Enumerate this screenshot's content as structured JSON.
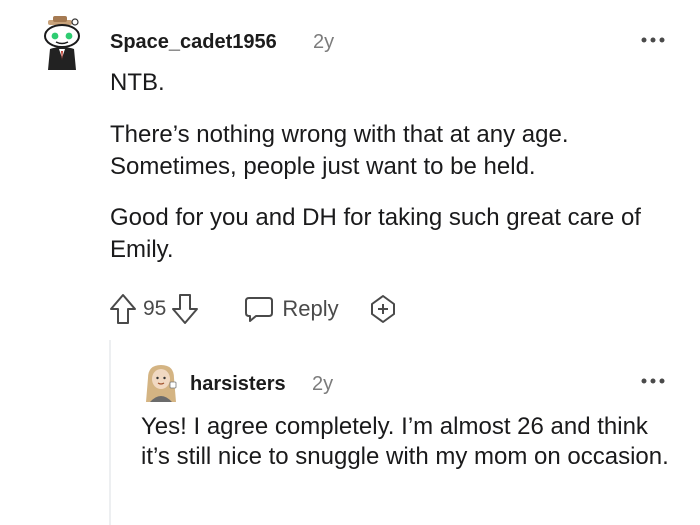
{
  "comment": {
    "username": "Space_cadet1956",
    "age": "2y",
    "paragraphs": [
      "NTB.",
      "There’s nothing wrong with that at any age. Sometimes, people just want to be held.",
      "Good for you and DH for taking such great care of Emily."
    ],
    "vote_count": "95",
    "reply_label": "Reply"
  },
  "reply": {
    "username": "harsisters",
    "age": "2y",
    "text": "Yes! I agree completely. I’m almost 26 and think it’s still nice to snuggle with my mom on occasion."
  },
  "icons": [
    "snoo-avatar-icon",
    "more-options-icon",
    "upvote-icon",
    "downvote-icon",
    "reply-bubble-icon",
    "award-icon",
    "user-avatar-icon"
  ],
  "colors": {
    "text": "#1a1a1b",
    "muted": "#7c7c7c",
    "icon": "#4a4a4a",
    "thread_line": "#edeff1"
  }
}
